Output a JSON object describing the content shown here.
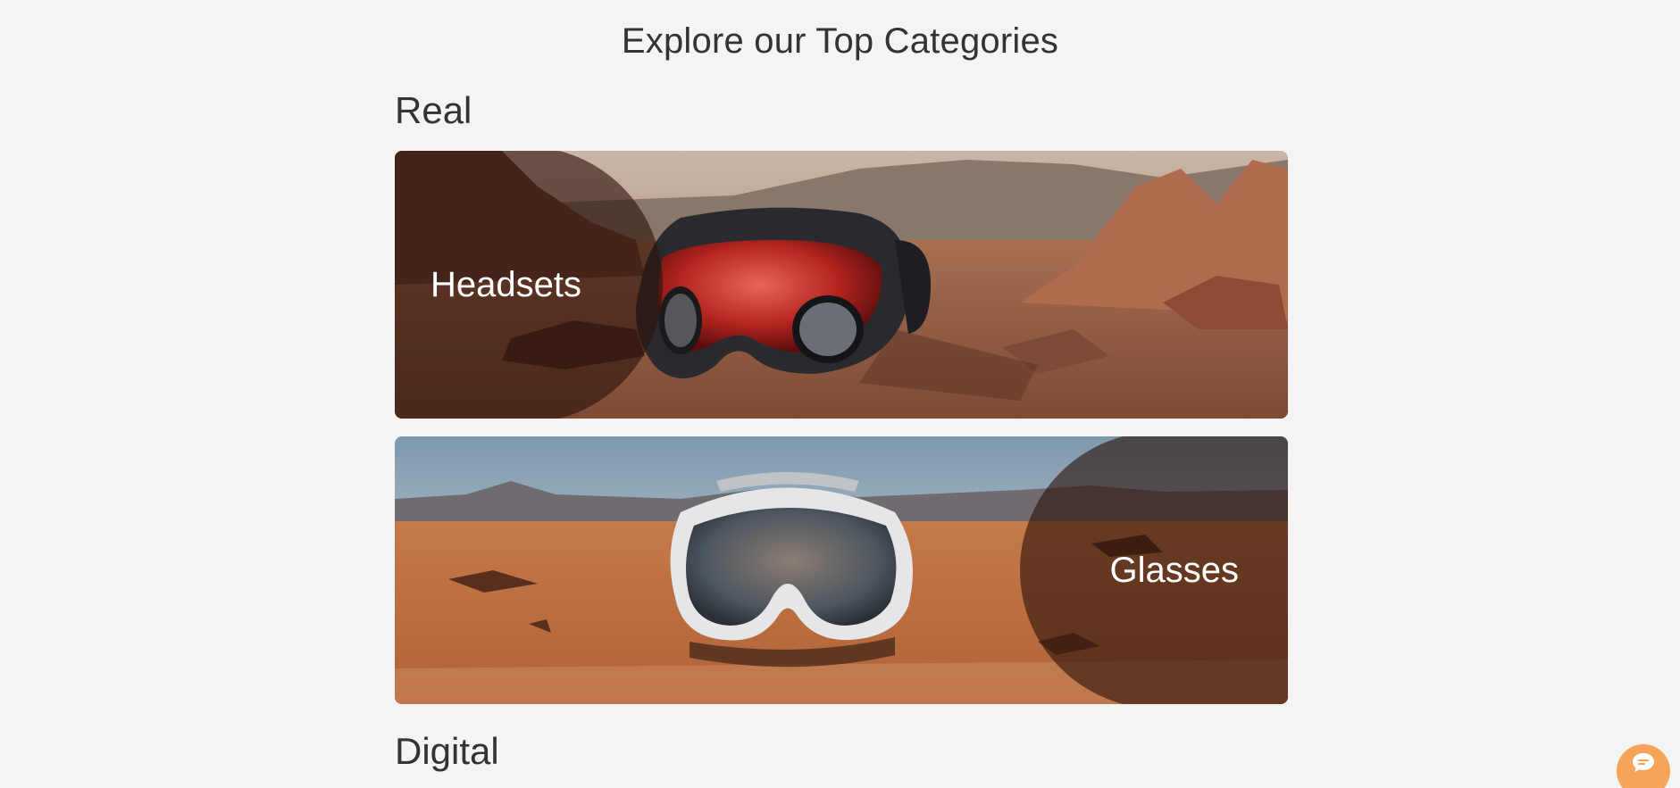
{
  "page": {
    "title": "Explore our Top Categories"
  },
  "sections": {
    "real": {
      "heading": "Real",
      "cards": [
        {
          "label": "Headsets"
        },
        {
          "label": "Glasses"
        }
      ]
    },
    "digital": {
      "heading": "Digital"
    }
  },
  "chat": {
    "icon": "chat-bubble-icon",
    "color": "#f6a45a"
  },
  "colors": {
    "background": "#f4f4f4",
    "text": "#333333",
    "overlay": "rgba(45, 20, 12, 0.62)"
  }
}
